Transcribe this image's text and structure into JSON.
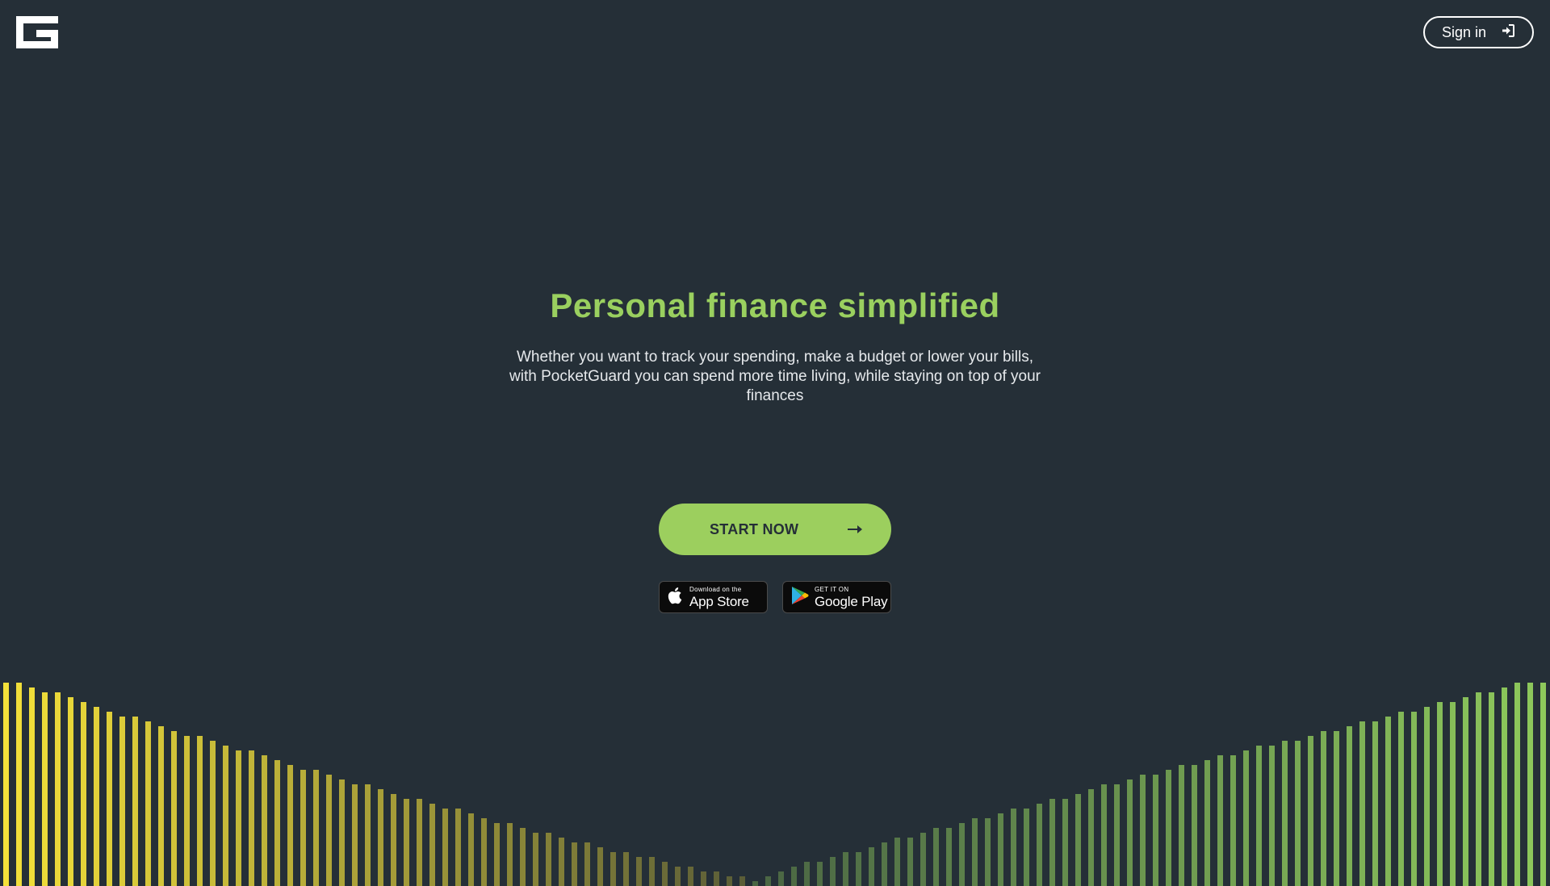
{
  "header": {
    "logo_icon": "pocketguard-logo-icon",
    "signin_label": "Sign in",
    "signin_icon": "sign-in-icon"
  },
  "hero": {
    "title": "Personal finance simplified",
    "subtitle": "Whether you want to track your spending, make a budget or lower your bills, with PocketGuard you can spend more time living, while staying on top of your finances",
    "cta_label": "START NOW",
    "cta_icon": "arrow-right-icon"
  },
  "stores": {
    "apple": {
      "small": "Download on the",
      "big": "App Store",
      "icon": "apple-icon"
    },
    "google": {
      "small": "GET IT ON",
      "big": "Google Play",
      "icon": "google-play-icon"
    }
  },
  "colors": {
    "background": "#252f37",
    "accent": "#9ccf5e",
    "bar_left": "#f5e23a",
    "bar_right": "#8fca5c"
  }
}
